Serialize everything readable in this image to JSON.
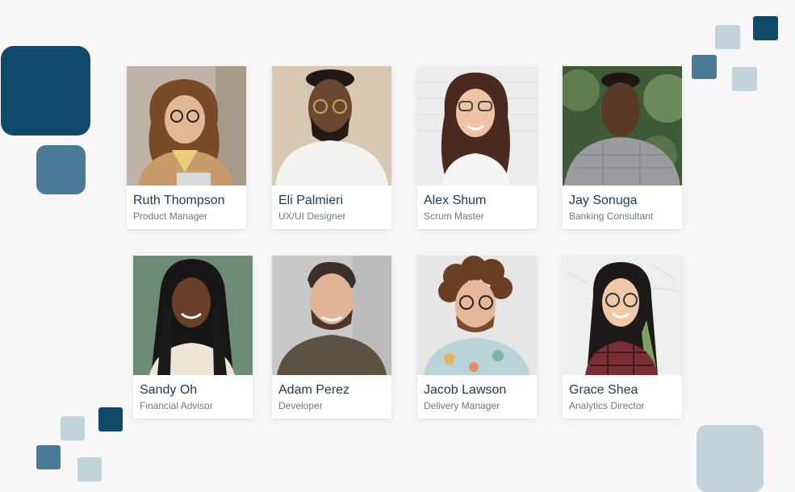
{
  "colors": {
    "background": "#f7f7f8",
    "dark_tile": "#0f4a6b",
    "mid_tile": "#4a7a95",
    "light_tile": "#c2d3dc",
    "name_text": "#1d3a4f",
    "title_text": "#6f7780"
  },
  "team": [
    {
      "name": "Ruth Thompson",
      "title": "Product Manager"
    },
    {
      "name": "Eli Palmieri",
      "title": "UX/UI Designer"
    },
    {
      "name": "Alex Shum",
      "title": "Scrum Master"
    },
    {
      "name": "Jay Sonuga",
      "title": "Banking Consultant"
    },
    {
      "name": "Sandy Oh",
      "title": "Financial Advisor"
    },
    {
      "name": "Adam Perez",
      "title": "Developer"
    },
    {
      "name": "Jacob Lawson",
      "title": "Delivery Manager"
    },
    {
      "name": "Grace Shea",
      "title": "Analytics Director"
    }
  ]
}
